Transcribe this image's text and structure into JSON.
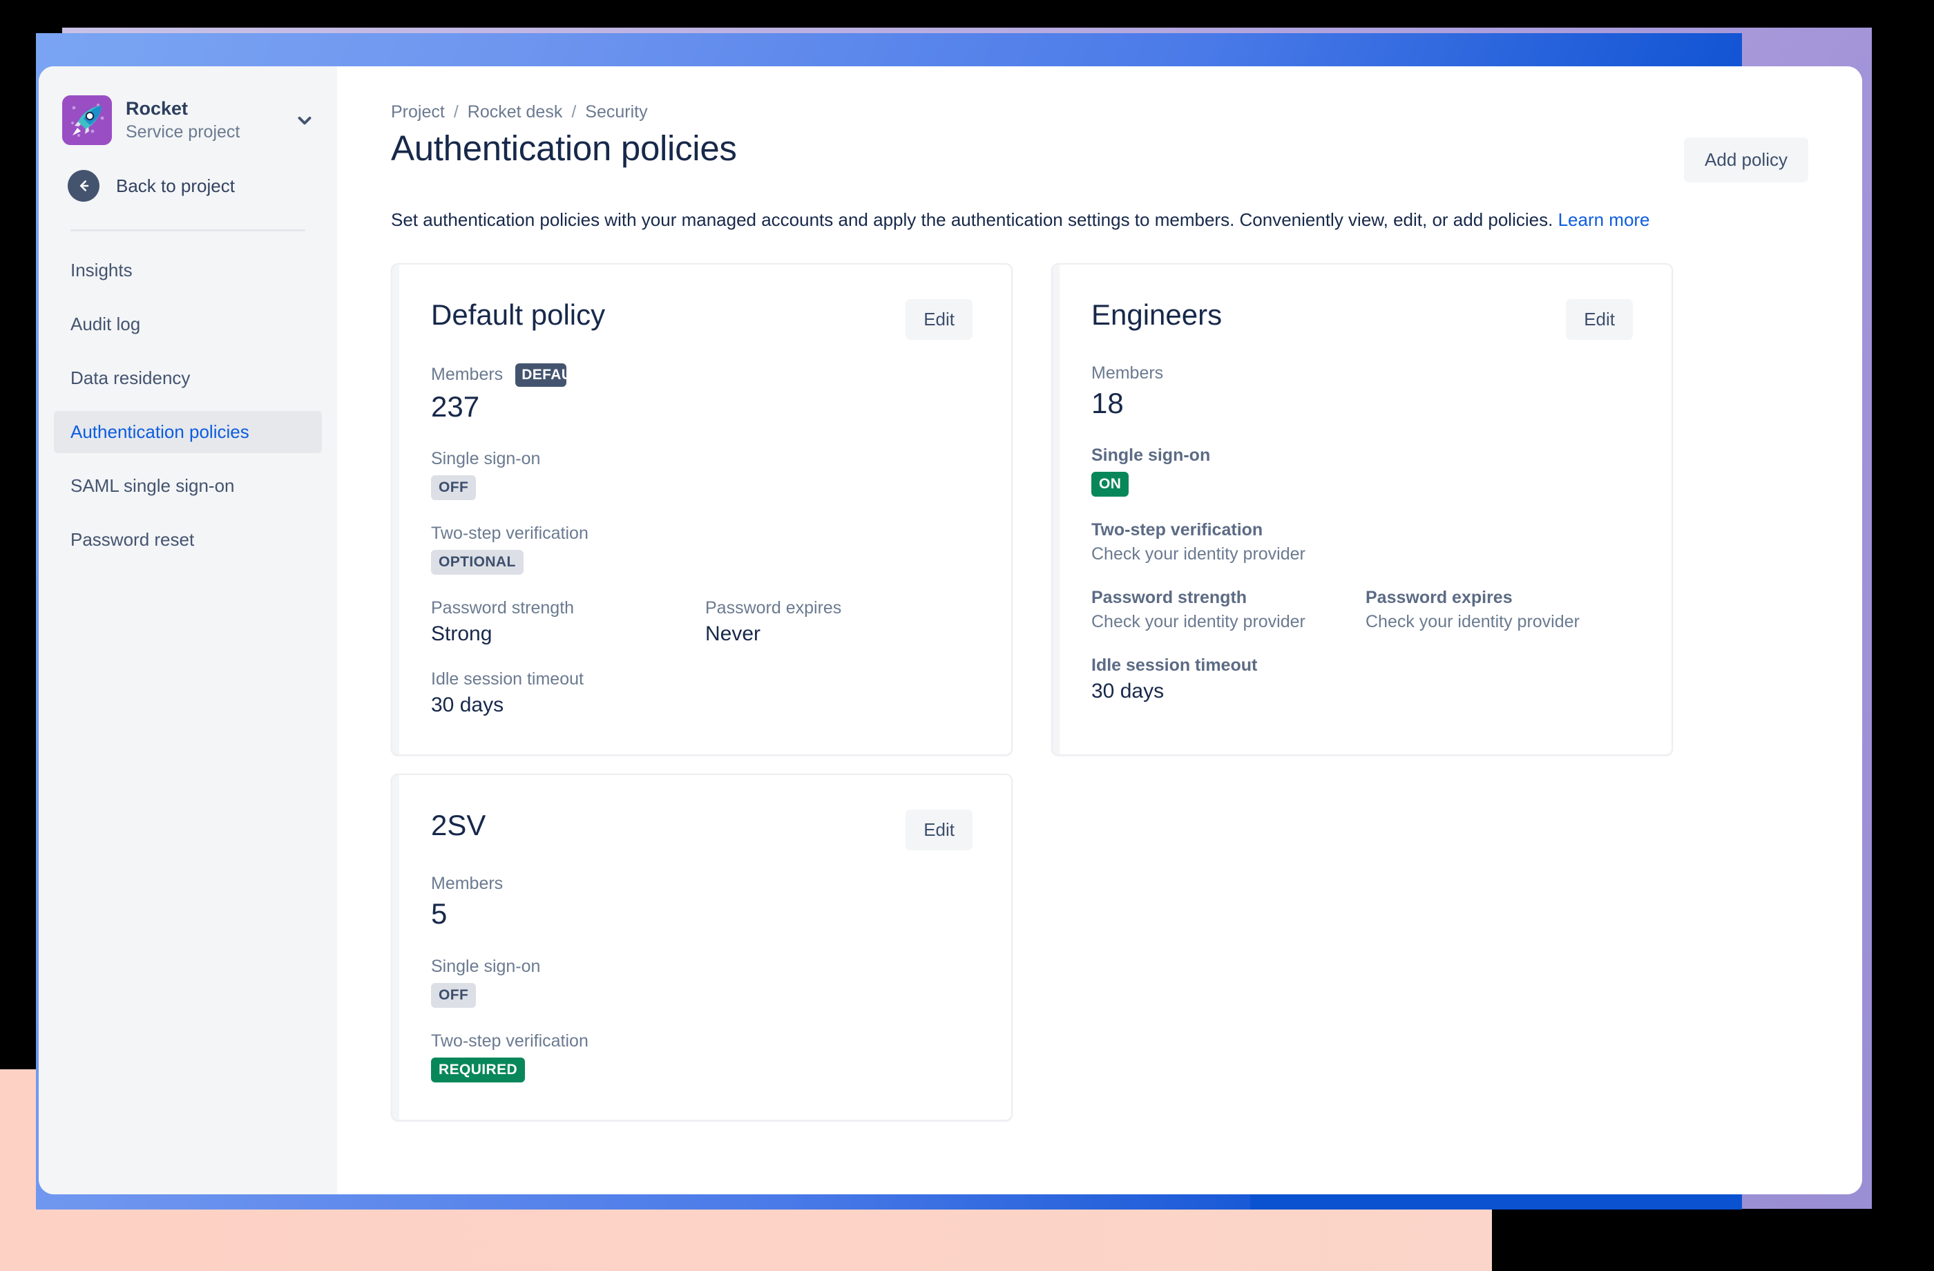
{
  "window": {
    "sidebar": {
      "project": {
        "name": "Rocket",
        "type": "Service project",
        "avatar_icon": "rocket-icon",
        "chevron_icon": "chevron-down-icon"
      },
      "back": {
        "label": "Back to project",
        "icon": "arrow-left-icon"
      },
      "nav_items": [
        {
          "label": "Insights",
          "active": false
        },
        {
          "label": "Audit log",
          "active": false
        },
        {
          "label": "Data residency",
          "active": false
        },
        {
          "label": "Authentication policies",
          "active": true
        },
        {
          "label": "SAML single sign-on",
          "active": false
        },
        {
          "label": "Password reset",
          "active": false
        }
      ]
    },
    "main": {
      "breadcrumb": [
        "Project",
        "Rocket desk",
        "Security"
      ],
      "breadcrumb_separator": "/",
      "page_title": "Authentication policies",
      "add_policy_label": "Add policy",
      "description_text": "Set authentication policies with your managed accounts and apply the authentication settings to members. Conveniently view, edit, or add policies.",
      "description_link": "Learn more",
      "labels": {
        "members": "Members",
        "single_sign_on": "Single sign-on",
        "two_step_verification": "Two-step verification",
        "password_strength": "Password strength",
        "password_expires": "Password expires",
        "idle_session_timeout": "Idle session timeout",
        "edit": "Edit"
      },
      "cards": [
        {
          "title": "Default policy",
          "edit_label": "Edit",
          "default_badge": "DEFAULT",
          "members": "237",
          "sso_badge": "OFF",
          "sso_badge_style": "neutral",
          "twosv_badge": "OPTIONAL",
          "twosv_badge_style": "neutral",
          "password_strength": "Strong",
          "password_expires": "Never",
          "idle_session_timeout": "30 days"
        },
        {
          "title": "Engineers",
          "edit_label": "Edit",
          "members": "18",
          "sso_badge": "ON",
          "sso_badge_style": "green",
          "twosv_note": "Check your identity provider",
          "password_strength_note": "Check your identity provider",
          "password_expires_note": "Check your identity provider",
          "idle_session_timeout": "30 days"
        },
        {
          "title": "2SV",
          "edit_label": "Edit",
          "members": "5",
          "sso_badge": "OFF",
          "sso_badge_style": "neutral",
          "twosv_badge": "REQUIRED",
          "twosv_badge_style": "green"
        }
      ]
    }
  },
  "colors": {
    "accent_blue": "#0c5ce0",
    "title_navy": "#17284a",
    "muted": "#6b7a90",
    "badge_green": "#08875a",
    "badge_neutral": "#dcdfe5",
    "lozenge_default": "#44546f",
    "sidebar_bg": "#f4f5f7",
    "avatar_purple": "#9a4ec4"
  }
}
